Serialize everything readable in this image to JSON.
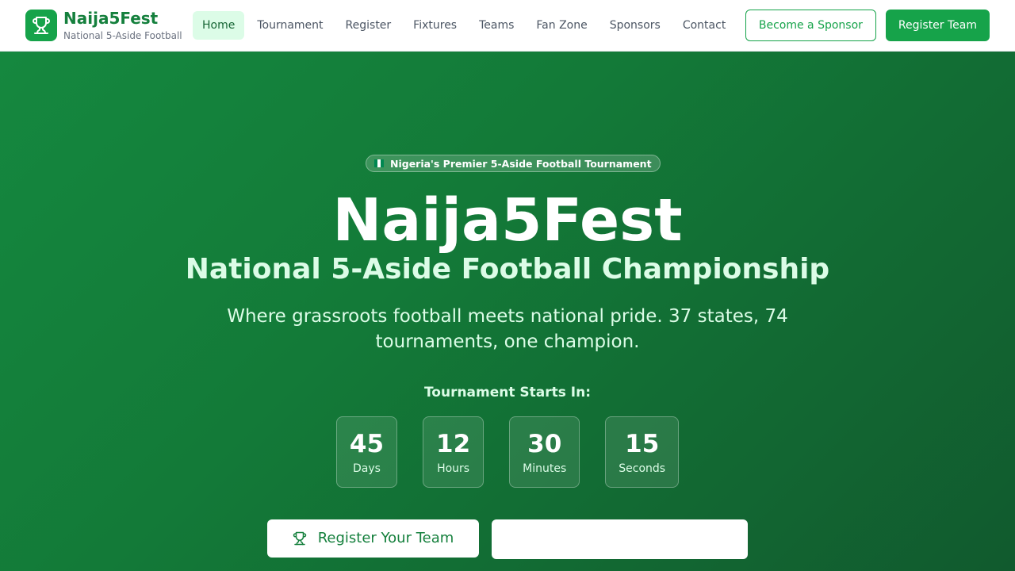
{
  "brand": {
    "name": "Naija5Fest",
    "tagline": "National 5-Aside Football",
    "icon": "trophy-icon"
  },
  "nav": {
    "items": [
      "Home",
      "Tournament",
      "Register",
      "Fixtures",
      "Teams",
      "Fan Zone",
      "Sponsors",
      "Contact"
    ],
    "active": "Home"
  },
  "header_actions": {
    "sponsor_label": "Become a Sponsor",
    "register_label": "Register Team"
  },
  "hero": {
    "badge": "Nigeria's Premier 5-Aside Football Tournament",
    "title": "Naija5Fest",
    "subtitle": "National 5-Aside Football Championship",
    "description": "Where grassroots football meets national pride. 37 states, 74 tournaments, one champion.",
    "countdown_label": "Tournament Starts In:",
    "countdown": [
      {
        "value": "45",
        "unit": "Days"
      },
      {
        "value": "12",
        "unit": "Hours"
      },
      {
        "value": "30",
        "unit": "Minutes"
      },
      {
        "value": "15",
        "unit": "Seconds"
      }
    ],
    "cta_primary": "Register Your Team",
    "cta_secondary": ""
  },
  "colors": {
    "accent": "#16a34a",
    "brand_text": "#15803d",
    "hero_start": "#15883f",
    "hero_end": "#115a2e"
  }
}
